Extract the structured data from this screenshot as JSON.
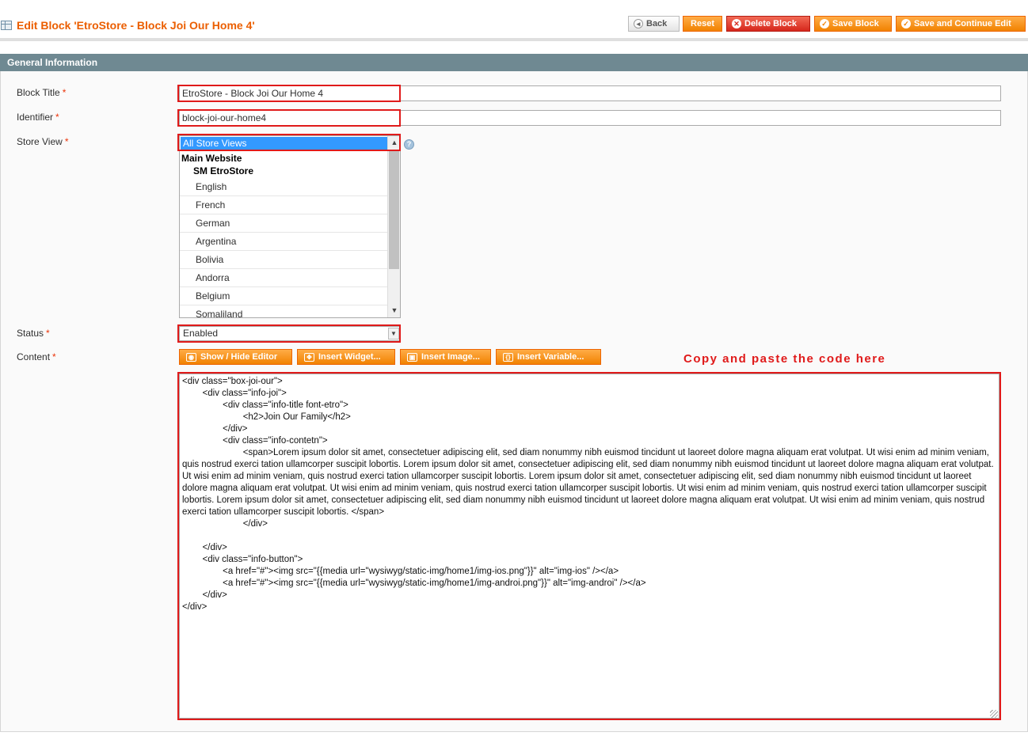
{
  "header": {
    "title": "Edit Block 'EtroStore - Block Joi Our Home 4'",
    "buttons": {
      "back": "Back",
      "reset": "Reset",
      "delete": "Delete Block",
      "save": "Save Block",
      "save_continue": "Save and Continue Edit"
    }
  },
  "section": {
    "title": "General Information"
  },
  "form": {
    "block_title": {
      "label": "Block Title",
      "value": "EtroStore - Block Joi Our Home 4"
    },
    "identifier": {
      "label": "Identifier",
      "value": "block-joi-our-home4"
    },
    "store_view": {
      "label": "Store View",
      "selected": "All Store Views",
      "group": "Main Website",
      "subgroup": "SM EtroStore",
      "options": [
        "English",
        "French",
        "German",
        "Argentina",
        "Bolivia",
        "Andorra",
        "Belgium",
        "Somaliland"
      ]
    },
    "status": {
      "label": "Status",
      "value": "Enabled"
    },
    "content": {
      "label": "Content",
      "buttons": {
        "show_hide": "Show / Hide Editor",
        "widget": "Insert Widget...",
        "image": "Insert Image...",
        "variable": "Insert Variable..."
      },
      "note": "Copy and paste the code here",
      "code": "<div class=\"box-joi-our\">\n\t<div class=\"info-joi\">\n\t\t<div class=\"info-title font-etro\">\n\t\t\t<h2>Join Our Family</h2>\n\t\t</div>\n\t\t<div class=\"info-contetn\">\n\t\t\t<span>Lorem ipsum dolor sit amet, consectetuer adipiscing elit, sed diam nonummy nibh euismod tincidunt ut laoreet dolore magna aliquam erat volutpat. Ut wisi enim ad minim veniam, quis nostrud exerci tation ullamcorper suscipit lobortis. Lorem ipsum dolor sit amet, consectetuer adipiscing elit, sed diam nonummy nibh euismod tincidunt ut laoreet dolore magna aliquam erat volutpat. Ut wisi enim ad minim veniam, quis nostrud exerci tation ullamcorper suscipit lobortis. Lorem ipsum dolor sit amet, consectetuer adipiscing elit, sed diam nonummy nibh euismod tincidunt ut laoreet dolore magna aliquam erat volutpat. Ut wisi enim ad minim veniam, quis nostrud exerci tation ullamcorper suscipit lobortis. Ut wisi enim ad minim veniam, quis nostrud exerci tation ullamcorper suscipit lobortis. Lorem ipsum dolor sit amet, consectetuer adipiscing elit, sed diam nonummy nibh euismod tincidunt ut laoreet dolore magna aliquam erat volutpat. Ut wisi enim ad minim veniam, quis nostrud exerci tation ullamcorper suscipit lobortis. </span>\n\t\t\t</div>\n\n\t</div>\n\t<div class=\"info-button\">\n\t\t<a href=\"#\"><img src=\"{{media url=\"wysiwyg/static-img/home1/img-ios.png\"}}\" alt=\"img-ios\" /></a>\n\t\t<a href=\"#\"><img src=\"{{media url=\"wysiwyg/static-img/home1/img-androi.png\"}}\" alt=\"img-androi\" /></a>\n\t</div>\n</div>"
    }
  },
  "colors": {
    "accent": "#eb5e00",
    "highlight": "#e01a1a",
    "section_bar": "#6f8992"
  },
  "icons": [
    "grid-icon",
    "back-arrow-icon",
    "delete-icon",
    "check-icon",
    "eye-icon",
    "widget-icon",
    "image-icon",
    "variable-icon",
    "help-icon"
  ]
}
